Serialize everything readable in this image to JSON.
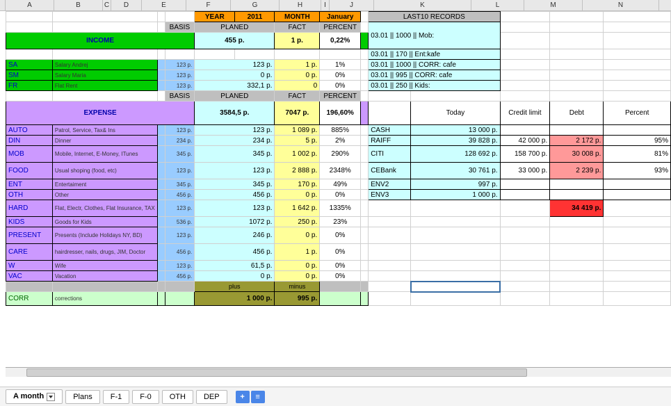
{
  "colheads": [
    "A",
    "B",
    "C",
    "D",
    "E",
    "F",
    "G",
    "H",
    "I",
    "J",
    "K",
    "L",
    "M",
    "N"
  ],
  "header": {
    "year_lbl": "YEAR",
    "year": "2011",
    "month_lbl": "MONTH",
    "month": "January",
    "basis": "BASIS",
    "planed": "PLANED",
    "fact": "FACT",
    "percent": "PERCENT"
  },
  "income": {
    "title": "INCOME",
    "planed": "455 р.",
    "fact": "1 р.",
    "percent": "0,22%",
    "rows": [
      {
        "code": "SA",
        "desc": "Salary Andrej",
        "basis": "123 р.",
        "planed": "123 р.",
        "fact": "1 р.",
        "pct": "1%"
      },
      {
        "code": "SM",
        "desc": "Salary Maria",
        "basis": "123 р.",
        "planed": "0 р.",
        "fact": "0 р.",
        "pct": "0%"
      },
      {
        "code": "FR",
        "desc": "Flat Rent",
        "basis": "123 р.",
        "planed": "332,1 р.",
        "fact": "0",
        "pct": "0%"
      }
    ]
  },
  "expense": {
    "title": "EXPENSE",
    "planed": "3584,5 р.",
    "fact": "7047 р.",
    "percent": "196,60%",
    "rows": [
      {
        "code": "AUTO",
        "desc": "Patrol, Service, Tax& Ins",
        "basis": "123 р.",
        "planed": "123 р.",
        "fact": "1 089 р.",
        "pct": "885%"
      },
      {
        "code": "DIN",
        "desc": "Dinner",
        "basis": "234 р.",
        "planed": "234 р.",
        "fact": "5 р.",
        "pct": "2%"
      },
      {
        "code": "MOB",
        "desc": "Mobile, Internet, E-Money, ITunes",
        "basis": "345 р.",
        "planed": "345 р.",
        "fact": "1 002 р.",
        "pct": "290%"
      },
      {
        "code": "FOOD",
        "desc": "Usual shoping (food, etc)",
        "basis": "123 р.",
        "planed": "123 р.",
        "fact": "2 888 р.",
        "pct": "2348%"
      },
      {
        "code": "ENT",
        "desc": "Entertaiment",
        "basis": "345 р.",
        "planed": "345 р.",
        "fact": "170 р.",
        "pct": "49%"
      },
      {
        "code": "OTH",
        "desc": "Other",
        "basis": "456 р.",
        "planed": "456 р.",
        "fact": "0 р.",
        "pct": "0%"
      },
      {
        "code": "HARD",
        "desc": "Flat, Electr, Clothes, Flat Insurance, TAX",
        "basis": "123 р.",
        "planed": "123 р.",
        "fact": "1 642 р.",
        "pct": "1335%"
      },
      {
        "code": "KIDS",
        "desc": "Goods for Kids",
        "basis": "536 р.",
        "planed": "1072 р.",
        "fact": "250 р.",
        "pct": "23%"
      },
      {
        "code": "PRESENT",
        "desc": "Presents (Include Holidays NY, BD)",
        "basis": "123 р.",
        "planed": "246 р.",
        "fact": "0 р.",
        "pct": "0%"
      },
      {
        "code": "CARE",
        "desc": "hairdresser, nails, drugs, JIM, Doctor",
        "basis": "456 р.",
        "planed": "456 р.",
        "fact": "1 р.",
        "pct": "0%"
      },
      {
        "code": "W",
        "desc": "Wife",
        "basis": "123 р.",
        "planed": "61,5 р.",
        "fact": "0 р.",
        "pct": "0%"
      },
      {
        "code": "VAC",
        "desc": "Vacation",
        "basis": "456 р.",
        "planed": "0 р.",
        "fact": "0 р.",
        "pct": "0%"
      }
    ]
  },
  "corr": {
    "code": "CORR",
    "desc": "corrections",
    "plus_lbl": "plus",
    "minus_lbl": "minus",
    "plus": "1 000 р.",
    "minus": "995 р."
  },
  "last10": {
    "title": "LAST10 RECORDS",
    "items": [
      "03.01 || 1000 || Mob:",
      "03.01 || 170 || Ent:kafe",
      "03.01 || 1000 || CORR: cafe",
      "03.01 || 995 || CORR: cafe",
      "03.01 || 250 || Kids:"
    ]
  },
  "accounts": {
    "hdr": {
      "today": "Today",
      "limit": "Credit limit",
      "debt": "Debt",
      "pct": "Percent"
    },
    "rows": [
      {
        "name": "CASH",
        "today": "13 000 р.",
        "limit": "",
        "debt": "",
        "pct": ""
      },
      {
        "name": "RAIFF",
        "today": "39 828 р.",
        "limit": "42 000 р.",
        "debt": "2 172 р.",
        "pct": "95%"
      },
      {
        "name": "CITI",
        "today": "128 692 р.",
        "limit": "158 700 р.",
        "debt": "30 008 р.",
        "pct": "81%"
      },
      {
        "name": "CEBank",
        "today": "30 761 р.",
        "limit": "33 000 р.",
        "debt": "2 239 р.",
        "pct": "93%"
      },
      {
        "name": "ENV2",
        "today": "997 р.",
        "limit": "",
        "debt": "",
        "pct": ""
      },
      {
        "name": "ENV3",
        "today": "1 000 р.",
        "limit": "",
        "debt": "",
        "pct": ""
      }
    ],
    "total_debt": "34 419 р."
  },
  "tabs": [
    "A month",
    "Plans",
    "F-1",
    "F-0",
    "OTH",
    "DEP"
  ],
  "btns": {
    "plus": "+",
    "menu": "≡"
  }
}
